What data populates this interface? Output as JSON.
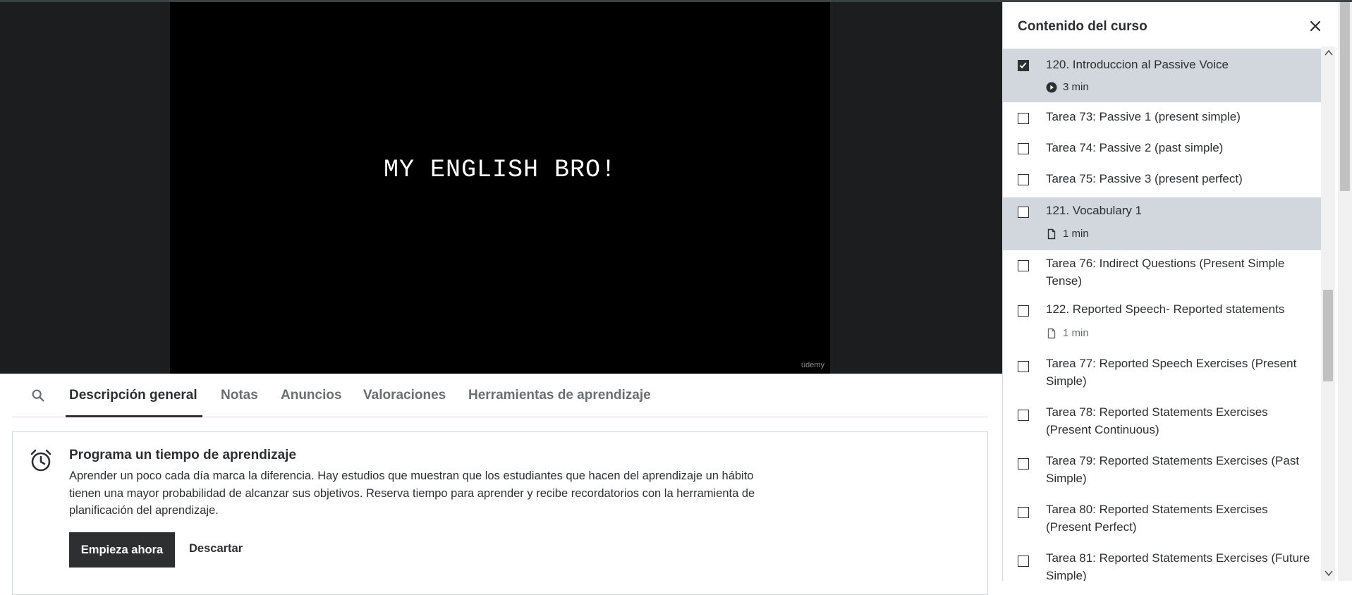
{
  "video": {
    "caption": "MY ENGLISH BRO!",
    "watermark": "ūdemy"
  },
  "tabs": [
    {
      "label": "Descripción general",
      "active": true
    },
    {
      "label": "Notas"
    },
    {
      "label": "Anuncios"
    },
    {
      "label": "Valoraciones"
    },
    {
      "label": "Herramientas de aprendizaje"
    }
  ],
  "reminder": {
    "title": "Programa un tiempo de aprendizaje",
    "text": "Aprender un poco cada día marca la diferencia. Hay estudios que muestran que los estudiantes que hacen del aprendizaje un hábito tienen una mayor probabilidad de alcanzar sus objetivos. Reserva tiempo para aprender y recibe recordatorios con la herramienta de planificación del aprendizaje.",
    "primary_button": "Empieza ahora",
    "dismiss_button": "Descartar"
  },
  "sidebar": {
    "title": "Contenido del curso",
    "items": [
      {
        "title": "120. Introduccion al Passive Voice",
        "meta": "3 min",
        "meta_icon": "play-icon",
        "checked": true
      },
      {
        "title": "Tarea 73: Passive 1 (present simple)"
      },
      {
        "title": "Tarea 74: Passive 2 (past simple)"
      },
      {
        "title": "Tarea 75: Passive 3 (present perfect)"
      },
      {
        "title": "121. Vocabulary 1",
        "meta": "1 min",
        "meta_icon": "file-icon"
      },
      {
        "title": "Tarea 76: Indirect Questions (Present Simple Tense)"
      },
      {
        "title": "122. Reported Speech- Reported statements",
        "meta": "1 min",
        "meta_icon": "file-icon"
      },
      {
        "title": "Tarea 77: Reported Speech Exercises (Present Simple)"
      },
      {
        "title": "Tarea 78: Reported Statements Exercises (Present Continuous)"
      },
      {
        "title": "Tarea 79: Reported Statements Exercises (Past Simple)"
      },
      {
        "title": "Tarea 80: Reported Statements Exercises (Present Perfect)"
      },
      {
        "title": "Tarea 81: Reported Statements Exercises (Future Simple)"
      }
    ]
  }
}
